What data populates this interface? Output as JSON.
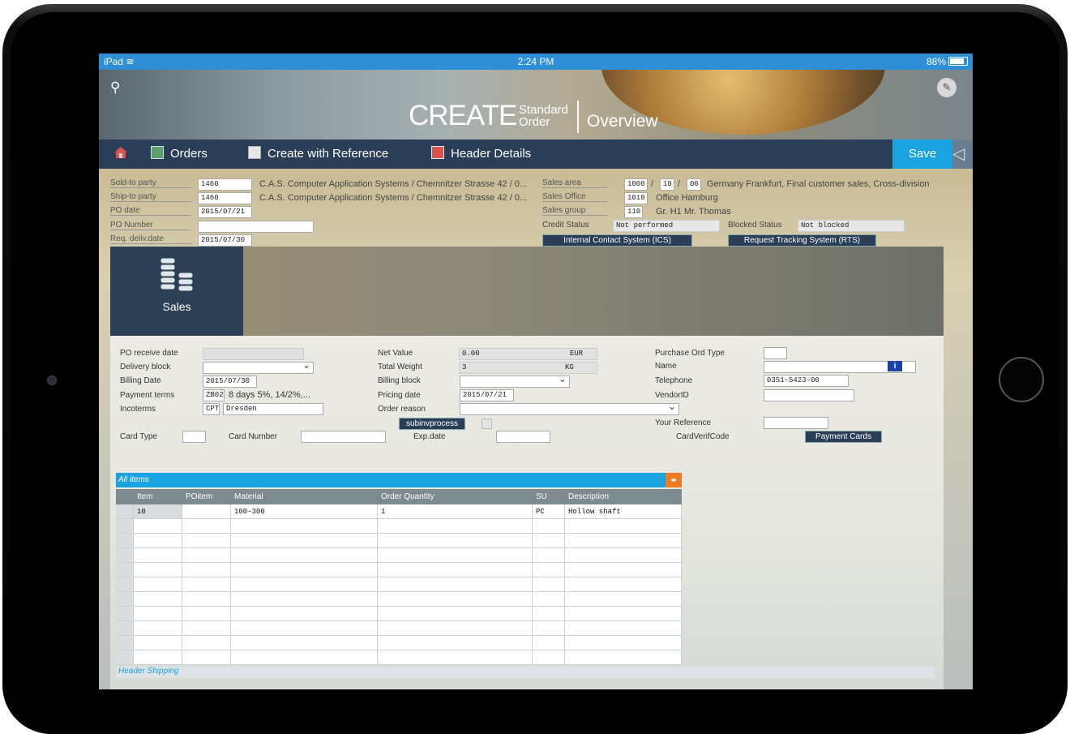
{
  "status_bar": {
    "device": "iPad",
    "time": "2:24 PM",
    "battery": "88%"
  },
  "banner": {
    "create": "CREATE",
    "standard": "Standard",
    "order": "Order",
    "overview": "Overview"
  },
  "toolbar": {
    "orders": "Orders",
    "create_ref": "Create with Reference",
    "header_details": "Header Details",
    "save": "Save"
  },
  "header": {
    "sold_to_label": "Sold-to party",
    "sold_to_value": "1460",
    "sold_to_desc": "C.A.S. Computer Application Systems / Chemnitzer Strasse 42 / 0...",
    "ship_to_label": "Ship-to party",
    "ship_to_value": "1460",
    "ship_to_desc": "C.A.S. Computer Application Systems / Chemnitzer Strasse 42 / 0...",
    "po_date_label": "PO date",
    "po_date_value": "2015/07/21",
    "po_number_label": "PO Number",
    "po_number_value": "",
    "req_deliv_label": "Req. deliv.date",
    "req_deliv_value": "2015/07/30",
    "sales_area_label": "Sales area",
    "sales_area_1": "1000",
    "sales_area_2": "10",
    "sales_area_3": "00",
    "sep": "/",
    "sales_area_desc": "Germany Frankfurt, Final customer sales, Cross-division",
    "sales_office_label": "Sales Office",
    "sales_office_value": "1010",
    "sales_office_desc": "Office Hamburg",
    "sales_group_label": "Sales group",
    "sales_group_value": "110",
    "sales_group_desc": "Gr. H1 Mr. Thomas",
    "credit_label": "Credit Status",
    "credit_value": "Not performed",
    "blocked_label": "Blocked Status",
    "blocked_value": "Not blocked",
    "ics_button": "Internal Contact System (ICS)",
    "rts_button": "Request Tracking System (RTS)"
  },
  "sales_tile": {
    "label": "Sales"
  },
  "form": {
    "po_receive_label": "PO receive date",
    "delivery_block_label": "Delivery block",
    "billing_date_label": "Billing Date",
    "billing_date_value": "2015/07/30",
    "payment_terms_label": "Payment terms",
    "payment_terms_code": "ZB02",
    "payment_terms_desc": "8 days 5%, 14/2%,...",
    "incoterms_label": "Incoterms",
    "incoterms_code": "CPT",
    "incoterms_place": "Dresden",
    "net_value_label": "Net Value",
    "net_value": "0.00",
    "net_currency": "EUR",
    "total_weight_label": "Total Weight",
    "total_weight": "3",
    "weight_unit": "KG",
    "billing_block_label": "Billing block",
    "pricing_date_label": "Pricing date",
    "pricing_date_value": "2015/07/21",
    "order_reason_label": "Order reason",
    "subinv_button": "subinvprocess",
    "purchase_type_label": "Purchase Ord Type",
    "name_label": "Name",
    "telephone_label": "Telephone",
    "telephone_value": "0351-5423-00",
    "vendor_label": "VendorID",
    "your_ref_label": "Your Reference",
    "card_type_label": "Card Type",
    "card_number_label": "Card Number",
    "exp_date_label": "Exp.date",
    "cardverif_label": "CardVerifCode",
    "payment_cards_button": "Payment Cards"
  },
  "items": {
    "title": "All items",
    "columns": [
      "Item",
      "POitem",
      "Material",
      "Order Quantity",
      "SU",
      "Description"
    ],
    "rows": [
      {
        "item": "10",
        "poitem": "",
        "material": "100-300",
        "qty": "1",
        "su": "PC",
        "desc": "Hollow shaft"
      }
    ]
  },
  "shipping": {
    "title": "Header Shipping"
  }
}
